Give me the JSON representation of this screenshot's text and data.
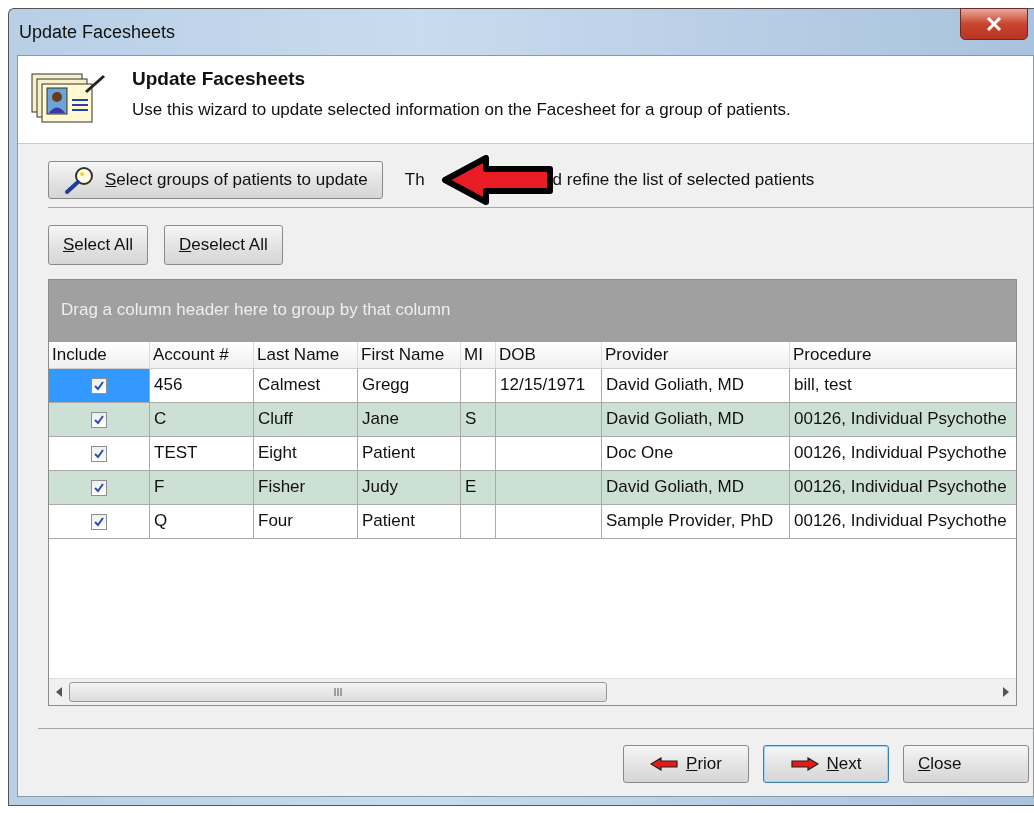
{
  "window": {
    "title": "Update Facesheets"
  },
  "header": {
    "title": "Update Facesheets",
    "description": "Use this wizard to update selected information on the Facesheet for a group of patients."
  },
  "select_groups_button": "Select groups of patients to update",
  "hint": {
    "before_arrow": "Th",
    "after_arrow": "d refine the list of selected patients"
  },
  "selection_buttons": [
    "Select All",
    "Deselect All"
  ],
  "grid": {
    "group_panel": "Drag a column header here to group by that column",
    "include_column": "Include",
    "columns": [
      "Account #",
      "Last Name",
      "First Name",
      "MI",
      "DOB",
      "Provider",
      "Procedure"
    ],
    "rows": [
      {
        "include": true,
        "focused": true,
        "cells": [
          "456",
          "Calmest",
          "Gregg",
          "",
          "12/15/1971",
          "David Goliath, MD",
          "bill, test"
        ]
      },
      {
        "include": true,
        "focused": false,
        "cells": [
          "C",
          "Cluff",
          "Jane",
          "S",
          "",
          "David Goliath, MD",
          "00126, Individual Psychothe"
        ]
      },
      {
        "include": true,
        "focused": false,
        "cells": [
          "TEST",
          "Eight",
          "Patient",
          "",
          "",
          "Doc One",
          "00126, Individual Psychothe"
        ]
      },
      {
        "include": true,
        "focused": false,
        "cells": [
          "F",
          "Fisher",
          "Judy",
          "E",
          "",
          "David Goliath, MD",
          "00126, Individual Psychothe"
        ]
      },
      {
        "include": true,
        "focused": false,
        "cells": [
          "Q",
          "Four",
          "Patient",
          "",
          "",
          "Sample Provider, PhD",
          "00126, Individual Psychothe"
        ]
      }
    ]
  },
  "nav_buttons": [
    {
      "kind": "prior",
      "label": "Prior",
      "default": false
    },
    {
      "kind": "next",
      "label": "Next",
      "default": true
    },
    {
      "kind": "close",
      "label": "Close",
      "default": false
    }
  ]
}
